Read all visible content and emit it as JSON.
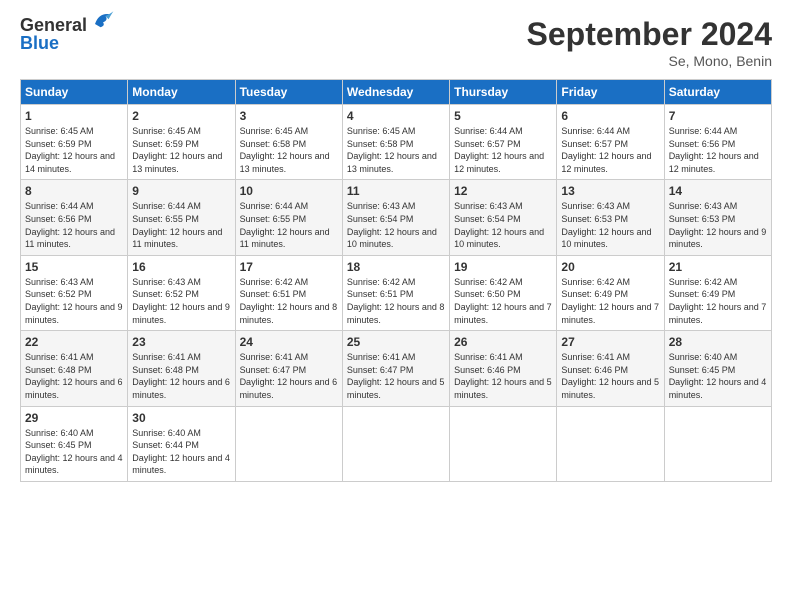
{
  "logo": {
    "general": "General",
    "blue": "Blue"
  },
  "header": {
    "title": "September 2024",
    "location": "Se, Mono, Benin"
  },
  "weekdays": [
    "Sunday",
    "Monday",
    "Tuesday",
    "Wednesday",
    "Thursday",
    "Friday",
    "Saturday"
  ],
  "weeks": [
    [
      {
        "day": "1",
        "info": "Sunrise: 6:45 AM\nSunset: 6:59 PM\nDaylight: 12 hours and 14 minutes."
      },
      {
        "day": "2",
        "info": "Sunrise: 6:45 AM\nSunset: 6:59 PM\nDaylight: 12 hours and 13 minutes."
      },
      {
        "day": "3",
        "info": "Sunrise: 6:45 AM\nSunset: 6:58 PM\nDaylight: 12 hours and 13 minutes."
      },
      {
        "day": "4",
        "info": "Sunrise: 6:45 AM\nSunset: 6:58 PM\nDaylight: 12 hours and 13 minutes."
      },
      {
        "day": "5",
        "info": "Sunrise: 6:44 AM\nSunset: 6:57 PM\nDaylight: 12 hours and 12 minutes."
      },
      {
        "day": "6",
        "info": "Sunrise: 6:44 AM\nSunset: 6:57 PM\nDaylight: 12 hours and 12 minutes."
      },
      {
        "day": "7",
        "info": "Sunrise: 6:44 AM\nSunset: 6:56 PM\nDaylight: 12 hours and 12 minutes."
      }
    ],
    [
      {
        "day": "8",
        "info": "Sunrise: 6:44 AM\nSunset: 6:56 PM\nDaylight: 12 hours and 11 minutes."
      },
      {
        "day": "9",
        "info": "Sunrise: 6:44 AM\nSunset: 6:55 PM\nDaylight: 12 hours and 11 minutes."
      },
      {
        "day": "10",
        "info": "Sunrise: 6:44 AM\nSunset: 6:55 PM\nDaylight: 12 hours and 11 minutes."
      },
      {
        "day": "11",
        "info": "Sunrise: 6:43 AM\nSunset: 6:54 PM\nDaylight: 12 hours and 10 minutes."
      },
      {
        "day": "12",
        "info": "Sunrise: 6:43 AM\nSunset: 6:54 PM\nDaylight: 12 hours and 10 minutes."
      },
      {
        "day": "13",
        "info": "Sunrise: 6:43 AM\nSunset: 6:53 PM\nDaylight: 12 hours and 10 minutes."
      },
      {
        "day": "14",
        "info": "Sunrise: 6:43 AM\nSunset: 6:53 PM\nDaylight: 12 hours and 9 minutes."
      }
    ],
    [
      {
        "day": "15",
        "info": "Sunrise: 6:43 AM\nSunset: 6:52 PM\nDaylight: 12 hours and 9 minutes."
      },
      {
        "day": "16",
        "info": "Sunrise: 6:43 AM\nSunset: 6:52 PM\nDaylight: 12 hours and 9 minutes."
      },
      {
        "day": "17",
        "info": "Sunrise: 6:42 AM\nSunset: 6:51 PM\nDaylight: 12 hours and 8 minutes."
      },
      {
        "day": "18",
        "info": "Sunrise: 6:42 AM\nSunset: 6:51 PM\nDaylight: 12 hours and 8 minutes."
      },
      {
        "day": "19",
        "info": "Sunrise: 6:42 AM\nSunset: 6:50 PM\nDaylight: 12 hours and 7 minutes."
      },
      {
        "day": "20",
        "info": "Sunrise: 6:42 AM\nSunset: 6:49 PM\nDaylight: 12 hours and 7 minutes."
      },
      {
        "day": "21",
        "info": "Sunrise: 6:42 AM\nSunset: 6:49 PM\nDaylight: 12 hours and 7 minutes."
      }
    ],
    [
      {
        "day": "22",
        "info": "Sunrise: 6:41 AM\nSunset: 6:48 PM\nDaylight: 12 hours and 6 minutes."
      },
      {
        "day": "23",
        "info": "Sunrise: 6:41 AM\nSunset: 6:48 PM\nDaylight: 12 hours and 6 minutes."
      },
      {
        "day": "24",
        "info": "Sunrise: 6:41 AM\nSunset: 6:47 PM\nDaylight: 12 hours and 6 minutes."
      },
      {
        "day": "25",
        "info": "Sunrise: 6:41 AM\nSunset: 6:47 PM\nDaylight: 12 hours and 5 minutes."
      },
      {
        "day": "26",
        "info": "Sunrise: 6:41 AM\nSunset: 6:46 PM\nDaylight: 12 hours and 5 minutes."
      },
      {
        "day": "27",
        "info": "Sunrise: 6:41 AM\nSunset: 6:46 PM\nDaylight: 12 hours and 5 minutes."
      },
      {
        "day": "28",
        "info": "Sunrise: 6:40 AM\nSunset: 6:45 PM\nDaylight: 12 hours and 4 minutes."
      }
    ],
    [
      {
        "day": "29",
        "info": "Sunrise: 6:40 AM\nSunset: 6:45 PM\nDaylight: 12 hours and 4 minutes."
      },
      {
        "day": "30",
        "info": "Sunrise: 6:40 AM\nSunset: 6:44 PM\nDaylight: 12 hours and 4 minutes."
      },
      null,
      null,
      null,
      null,
      null
    ]
  ]
}
